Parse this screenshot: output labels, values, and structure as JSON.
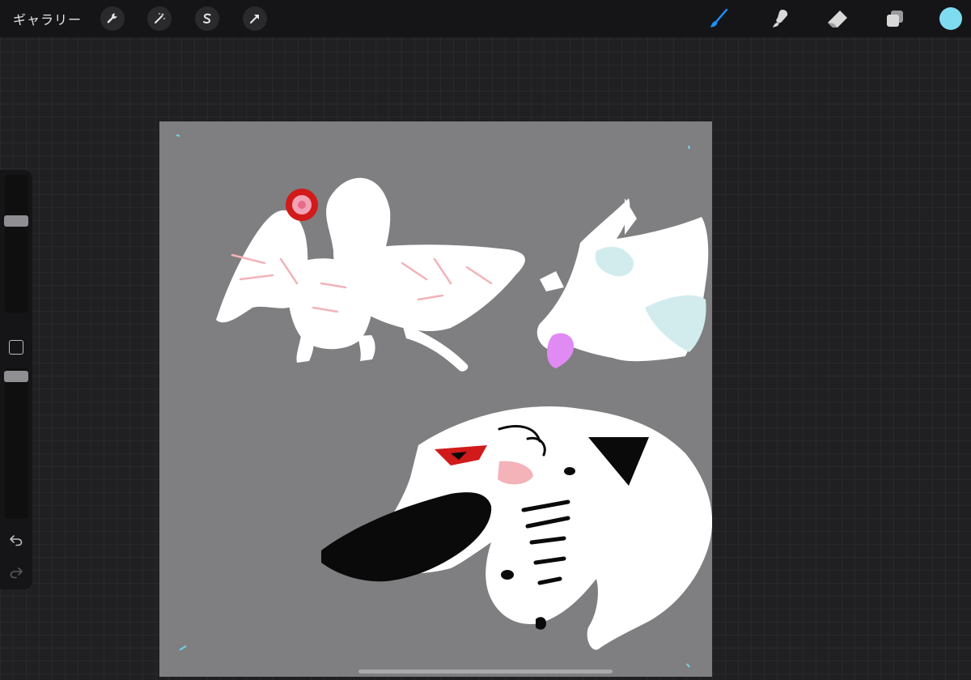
{
  "toolbar": {
    "gallery_label": "ギャラリー",
    "left_tools": [
      {
        "name": "actions",
        "icon": "wrench-icon"
      },
      {
        "name": "adjustments",
        "icon": "magic-wand-icon"
      },
      {
        "name": "selection",
        "icon": "selection-s-icon"
      },
      {
        "name": "transform",
        "icon": "arrow-cursor-icon"
      }
    ],
    "right_tools": [
      {
        "name": "brush",
        "icon": "brush-icon",
        "active": true
      },
      {
        "name": "smudge",
        "icon": "smudge-icon",
        "active": false
      },
      {
        "name": "eraser",
        "icon": "eraser-icon",
        "active": false
      },
      {
        "name": "layers",
        "icon": "layers-icon",
        "active": false
      }
    ],
    "active_color": "#7fdcf0",
    "active_tool_color": "#1e90ff"
  },
  "sidebar": {
    "brush_size_level": 0.68,
    "brush_opacity_level": 0.98
  },
  "canvas": {
    "background_color": "#7f7e80"
  }
}
